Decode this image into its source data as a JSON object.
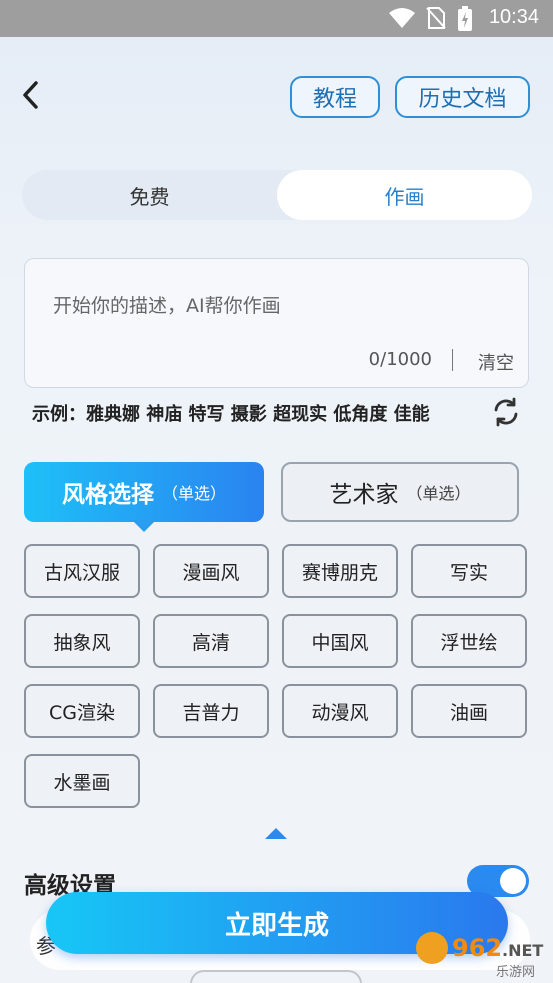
{
  "status_bar": {
    "time": "10:34"
  },
  "header": {
    "tutorial_label": "教程",
    "history_label": "历史文档"
  },
  "tabs": [
    {
      "label": "免费"
    },
    {
      "label": "作画"
    }
  ],
  "prompt": {
    "placeholder": "开始你的描述，AI帮你作画",
    "counter": "0/1000",
    "clear_label": "清空"
  },
  "examples": "示例：雅典娜 神庙 特写 摄影 超现实 低角度 佳能",
  "style_tabs": {
    "style": {
      "label": "风格选择",
      "hint": "（单选）"
    },
    "artist": {
      "label": "艺术家",
      "hint": "（单选）"
    }
  },
  "styles": [
    "古风汉服",
    "漫画风",
    "赛博朋克",
    "写实",
    "抽象风",
    "高清",
    "中国风",
    "浮世绘",
    "CG渲染",
    "吉普力",
    "动漫风",
    "油画",
    "水墨画"
  ],
  "advanced": {
    "title": "高级设置",
    "enabled": true,
    "partial_label": "参"
  },
  "generate_label": "立即生成",
  "watermark": {
    "text": "962.NET",
    "sub": "乐游网"
  },
  "colors": {
    "accent": "#2a8af0",
    "gradient_start": "#17c7f6",
    "gradient_end": "#2a78ee"
  },
  "icons": [
    "back-arrow-icon",
    "wifi-icon",
    "no-sim-icon",
    "battery-icon",
    "refresh-icon",
    "collapse-arrow-icon"
  ]
}
